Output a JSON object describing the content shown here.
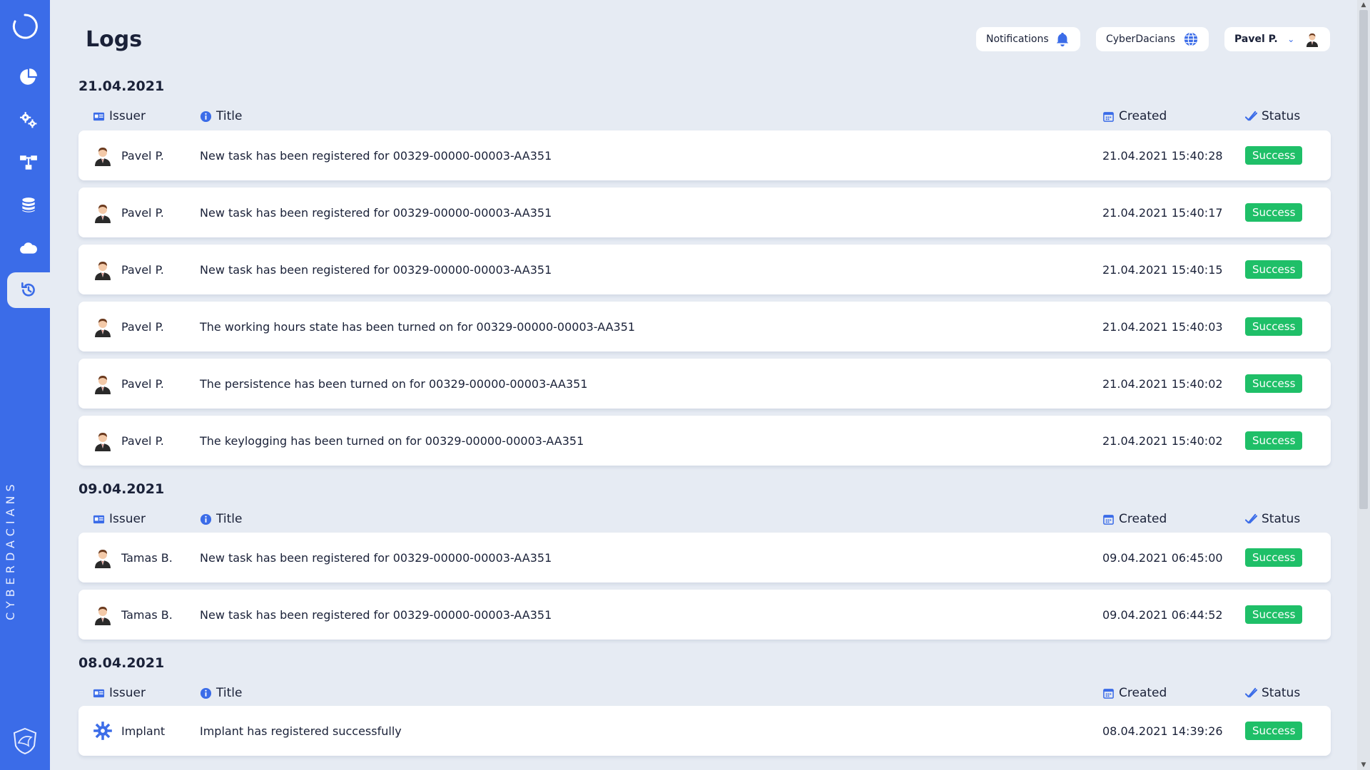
{
  "header": {
    "title": "Logs",
    "notifications_label": "Notifications",
    "org_label": "CyberDacians",
    "user_label": "Pavel P."
  },
  "brand": {
    "line1": "CYBER",
    "line2": "DACIANS"
  },
  "sidebar": {
    "items": [
      {
        "icon": "pie-chart-icon"
      },
      {
        "icon": "gears-icon"
      },
      {
        "icon": "network-icon"
      },
      {
        "icon": "database-icon"
      },
      {
        "icon": "cloud-icon"
      },
      {
        "icon": "history-icon",
        "active": true
      }
    ]
  },
  "columns": {
    "issuer": "Issuer",
    "title": "Title",
    "created": "Created",
    "status": "Status"
  },
  "groups": [
    {
      "date": "21.04.2021",
      "rows": [
        {
          "issuer": "Pavel P.",
          "title": "New task has been registered for 00329-00000-00003-AA351",
          "created": "21.04.2021 15:40:28",
          "status": "Success"
        },
        {
          "issuer": "Pavel P.",
          "title": "New task has been registered for 00329-00000-00003-AA351",
          "created": "21.04.2021 15:40:17",
          "status": "Success"
        },
        {
          "issuer": "Pavel P.",
          "title": "New task has been registered for 00329-00000-00003-AA351",
          "created": "21.04.2021 15:40:15",
          "status": "Success"
        },
        {
          "issuer": "Pavel P.",
          "title": "The working hours state has been turned on for 00329-00000-00003-AA351",
          "created": "21.04.2021 15:40:03",
          "status": "Success"
        },
        {
          "issuer": "Pavel P.",
          "title": "The persistence has been turned on for 00329-00000-00003-AA351",
          "created": "21.04.2021 15:40:02",
          "status": "Success"
        },
        {
          "issuer": "Pavel P.",
          "title": "The keylogging has been turned on for 00329-00000-00003-AA351",
          "created": "21.04.2021 15:40:02",
          "status": "Success"
        }
      ]
    },
    {
      "date": "09.04.2021",
      "rows": [
        {
          "issuer": "Tamas B.",
          "title": "New task has been registered for 00329-00000-00003-AA351",
          "created": "09.04.2021 06:45:00",
          "status": "Success"
        },
        {
          "issuer": "Tamas B.",
          "title": "New task has been registered for 00329-00000-00003-AA351",
          "created": "09.04.2021 06:44:52",
          "status": "Success"
        }
      ]
    },
    {
      "date": "08.04.2021",
      "rows": [
        {
          "issuer": "Implant",
          "title": "Implant has registered successfully",
          "created": "08.04.2021 14:39:26",
          "status": "Success",
          "issuer_icon": "gear-icon"
        }
      ]
    }
  ],
  "colors": {
    "accent": "#3b6ce8",
    "success": "#1fbf68",
    "background": "#e6ebf3"
  }
}
